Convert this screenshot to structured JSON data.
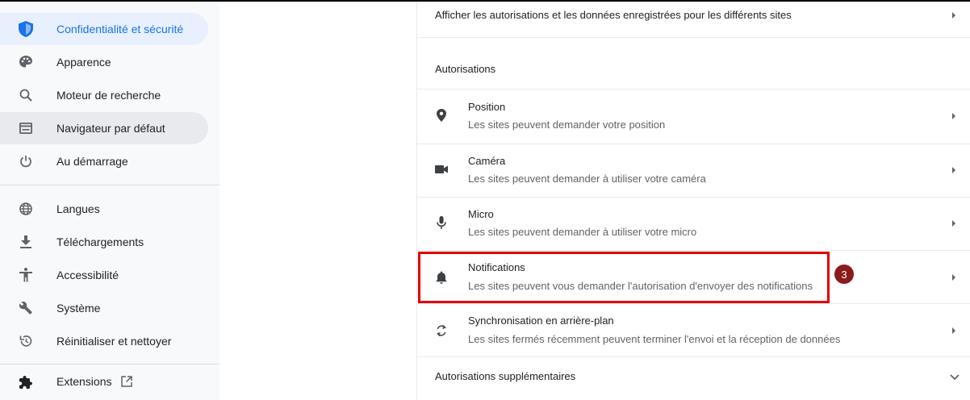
{
  "sidebar": {
    "items": [
      {
        "label": "Confidentialité et sécurité",
        "icon": "shield-icon",
        "selected": true
      },
      {
        "label": "Apparence",
        "icon": "palette-icon"
      },
      {
        "label": "Moteur de recherche",
        "icon": "search-icon"
      },
      {
        "label": "Navigateur par défaut",
        "icon": "browser-icon",
        "hover": true
      },
      {
        "label": "Au démarrage",
        "icon": "power-icon"
      },
      {
        "label": "Langues",
        "icon": "globe-icon"
      },
      {
        "label": "Téléchargements",
        "icon": "download-icon"
      },
      {
        "label": "Accessibilité",
        "icon": "accessibility-icon"
      },
      {
        "label": "Système",
        "icon": "wrench-icon"
      },
      {
        "label": "Réinitialiser et nettoyer",
        "icon": "restore-icon"
      },
      {
        "label": "Extensions",
        "icon": "puzzle-icon"
      }
    ]
  },
  "main": {
    "top_row_label": "Afficher les autorisations et les données enregistrées pour les différents sites",
    "section_title": "Autorisations",
    "permissions": [
      {
        "title": "Position",
        "subtitle": "Les sites peuvent demander votre position",
        "icon": "location-pin-icon"
      },
      {
        "title": "Caméra",
        "subtitle": "Les sites peuvent demander à utiliser votre caméra",
        "icon": "camera-icon"
      },
      {
        "title": "Micro",
        "subtitle": "Les sites peuvent demander à utiliser votre micro",
        "icon": "microphone-icon"
      },
      {
        "title": "Notifications",
        "subtitle": "Les sites peuvent vous demander l'autorisation d'envoyer des notifications",
        "icon": "bell-icon"
      },
      {
        "title": "Synchronisation en arrière-plan",
        "subtitle": "Les sites fermés récemment peuvent terminer l'envoi et la réception de données",
        "icon": "sync-icon"
      }
    ],
    "more_permissions_label": "Autorisations supplémentaires"
  },
  "annotation": {
    "step_number": "3",
    "highlight_color": "#e30000",
    "badge_color": "#8b1a1a"
  },
  "colors": {
    "accent": "#1a73e8",
    "selected_bg": "#e8f0fe",
    "hover_bg": "#e8eaed",
    "sidebar_bg": "#f8f9fa"
  }
}
